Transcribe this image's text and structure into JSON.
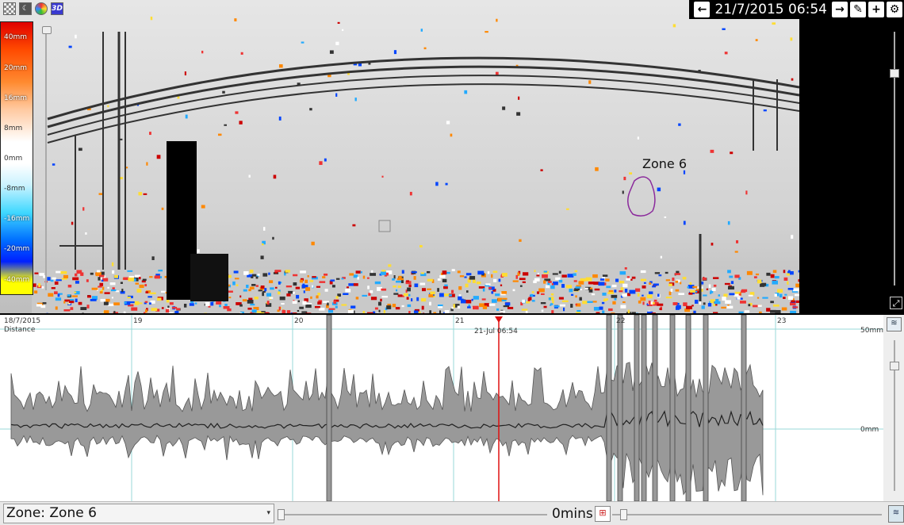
{
  "toolbar": {
    "icons": [
      "grid-icon",
      "moon-icon",
      "palette-icon",
      "3d-icon"
    ],
    "three_d_label": "3D"
  },
  "header": {
    "date": "21/7/2015 06:54",
    "prev_icon": "arrow-left-icon",
    "next_icon": "arrow-right-icon",
    "edit_icon": "pencil-icon",
    "add_icon": "plus-icon",
    "settings_icon": "gear-icon"
  },
  "legend": {
    "labels": [
      "40mm",
      "20mm",
      "16mm",
      "8mm",
      "0mm",
      "-8mm",
      "-16mm",
      "-20mm",
      "-40mm"
    ]
  },
  "viewer": {
    "zone_label": "Zone 6"
  },
  "chart": {
    "dates": [
      "18/7/2015",
      "19",
      "20",
      "21",
      "22",
      "23"
    ],
    "distance_label": "Distance",
    "cursor_label": "21-Jul 06:54",
    "y_top_label": "50mm",
    "y_zero_label": "0mm"
  },
  "chart_data": {
    "type": "area",
    "x_label": "",
    "y_label": "Distance",
    "ylim": [
      -50,
      50
    ],
    "x_categories": [
      "18/7/2015",
      "19",
      "20",
      "21",
      "22",
      "23"
    ],
    "cursor": "21-Jul 06:54",
    "series": [
      {
        "name": "",
        "kind": "mean-with-range",
        "mean_approx": 0,
        "range_approx": [
          -8,
          12
        ],
        "spikes_after": "22"
      }
    ]
  },
  "bottom": {
    "zone_select": "Zone: Zone 6",
    "mins_label": "0mins"
  },
  "colors": {
    "cursor": "#e01010",
    "band": "#999999",
    "grid": "#9ad8d8",
    "zone_outline": "#8b2a9c"
  }
}
